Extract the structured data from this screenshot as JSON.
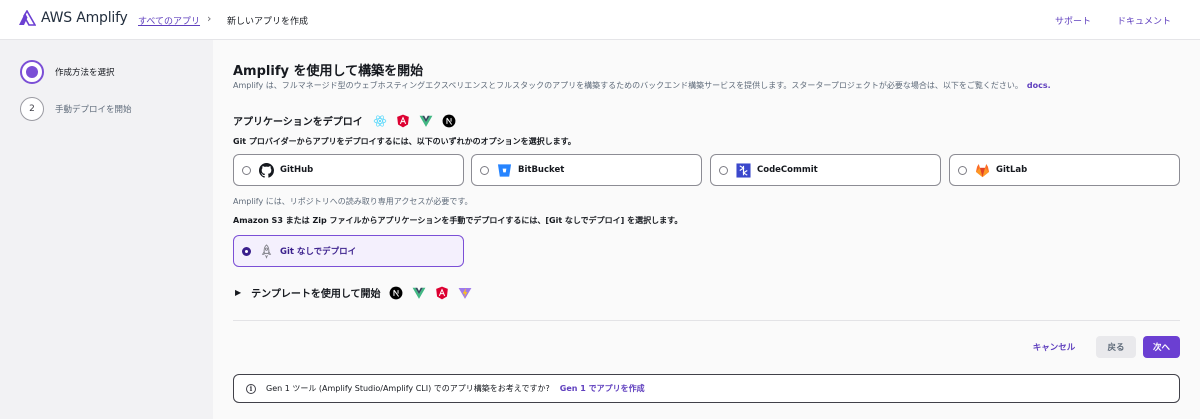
{
  "header": {
    "logo_text": "AWS Amplify",
    "breadcrumb_link": "すべてのアプリ",
    "breadcrumb_sep": "›",
    "breadcrumb_current": "新しいアプリを作成",
    "support_link": "サポート",
    "docs_link": "ドキュメント"
  },
  "sidebar": {
    "steps": [
      {
        "label": "作成方法を選択",
        "state": "active"
      },
      {
        "number": "2",
        "label": "手動デプロイを開始",
        "state": "pending"
      }
    ]
  },
  "main": {
    "title": "Amplify を使用して構築を開始",
    "description": "Amplify は、フルマネージド型のウェブホスティングエクスペリエンスとフルスタックのアプリを構築するためのバックエンド構築サービスを提供します。スタータープロジェクトが必要な場合は、以下をご覧ください。",
    "description_link": "docs.",
    "deploy_heading": "アプリケーションをデプロイ",
    "deploy_icons": [
      "react-icon",
      "angular-icon",
      "vue-icon",
      "nextjs-icon"
    ],
    "provider_prompt": "Git プロバイダーからアプリをデプロイするには、以下のいずれかのオプションを選択します。",
    "providers": [
      {
        "label": "GitHub",
        "icon": "github-icon"
      },
      {
        "label": "BitBucket",
        "icon": "bitbucket-icon"
      },
      {
        "label": "CodeCommit",
        "icon": "codecommit-icon"
      },
      {
        "label": "GitLab",
        "icon": "gitlab-icon"
      }
    ],
    "access_note": "Amplify には、リポジトリへの読み取り専用アクセスが必要です。",
    "manual_prompt": "Amazon S3 または Zip ファイルからアプリケーションを手動でデプロイするには、[Git なしでデプロイ] を選択します。",
    "gitless_label": "Git なしでデプロイ",
    "gitless_selected": true,
    "template_heading": "テンプレートを使用して開始",
    "template_icons": [
      "nextjs-icon",
      "vue-icon",
      "angular-icon",
      "vite-icon"
    ]
  },
  "actions": {
    "cancel": "キャンセル",
    "back": "戻る",
    "next": "次へ"
  },
  "info": {
    "icon_glyph": "i",
    "text": "Gen 1 ツール (Amplify Studio/Amplify CLI) でのアプリ構築をお考えですか?",
    "link": "Gen 1 でアプリを作成"
  },
  "colors": {
    "accent": "#6b3fd2",
    "link": "#5f3fbe",
    "selected_bg": "#f4f0fd"
  }
}
